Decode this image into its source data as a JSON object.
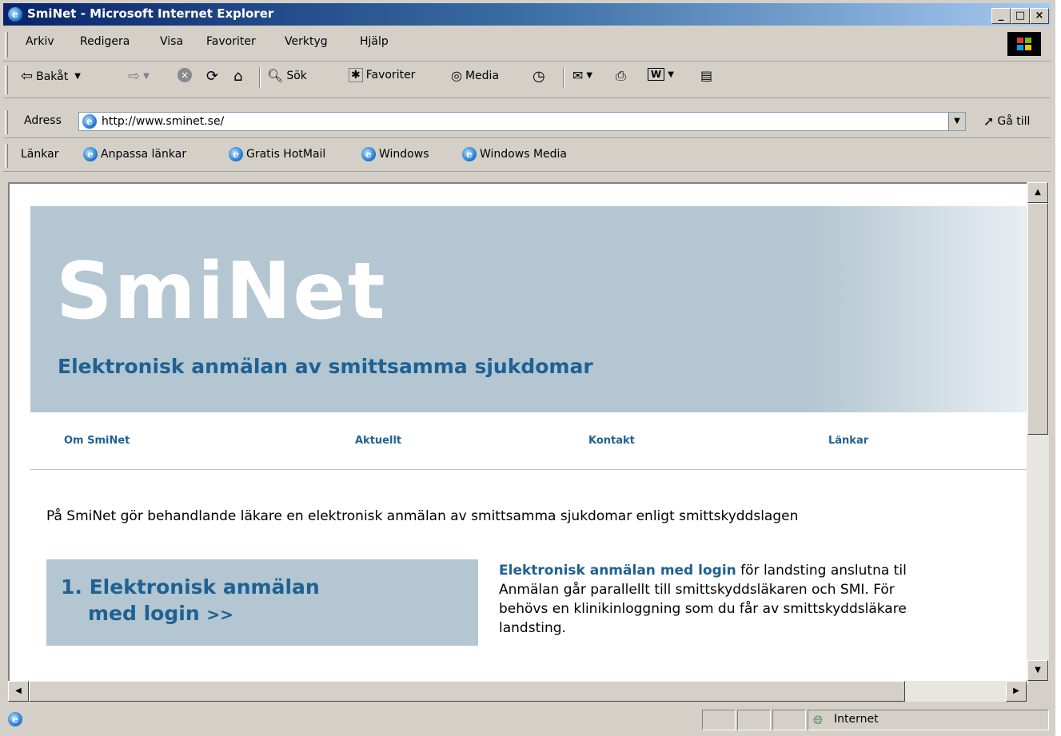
{
  "window": {
    "title": "SmiNet - Microsoft Internet Explorer"
  },
  "menu": [
    "Arkiv",
    "Redigera",
    "Visa",
    "Favoriter",
    "Verktyg",
    "Hjälp"
  ],
  "toolbar": {
    "back": "Bakåt",
    "search": "Sök",
    "favorites": "Favoriter",
    "media": "Media"
  },
  "address": {
    "label": "Adress",
    "url": "http://www.sminet.se/",
    "go": "Gå till"
  },
  "links": {
    "label": "Länkar",
    "items": [
      "Anpassa länkar",
      "Gratis HotMail",
      "Windows",
      "Windows Media"
    ]
  },
  "page": {
    "logo": "SmiNet",
    "tagline": "Elektronisk anmälan av smittsamma sjukdomar",
    "nav": [
      "Om SmiNet",
      "Aktuellt",
      "Kontakt",
      "Länkar"
    ],
    "intro": "På SmiNet gör behandlande läkare en elektronisk anmälan av smittsamma sjukdomar enligt smittskyddslagen",
    "box_line1": "1. Elektronisk anmälan",
    "box_line2": "med login",
    "box_arrow": ">>",
    "desc_highlight": "Elektronisk anmälan med login",
    "desc_line1_rest": " för landsting anslutna til",
    "desc_line2": "Anmälan går parallellt till smittskyddsläkaren och SMI. För",
    "desc_line3": "behövs en klinikinloggning som du får av smittskyddsläkare",
    "desc_line4": "landsting."
  },
  "status": {
    "zone": "Internet"
  },
  "colors": {
    "accent": "#1f6193",
    "banner": "#b3c6d1"
  }
}
